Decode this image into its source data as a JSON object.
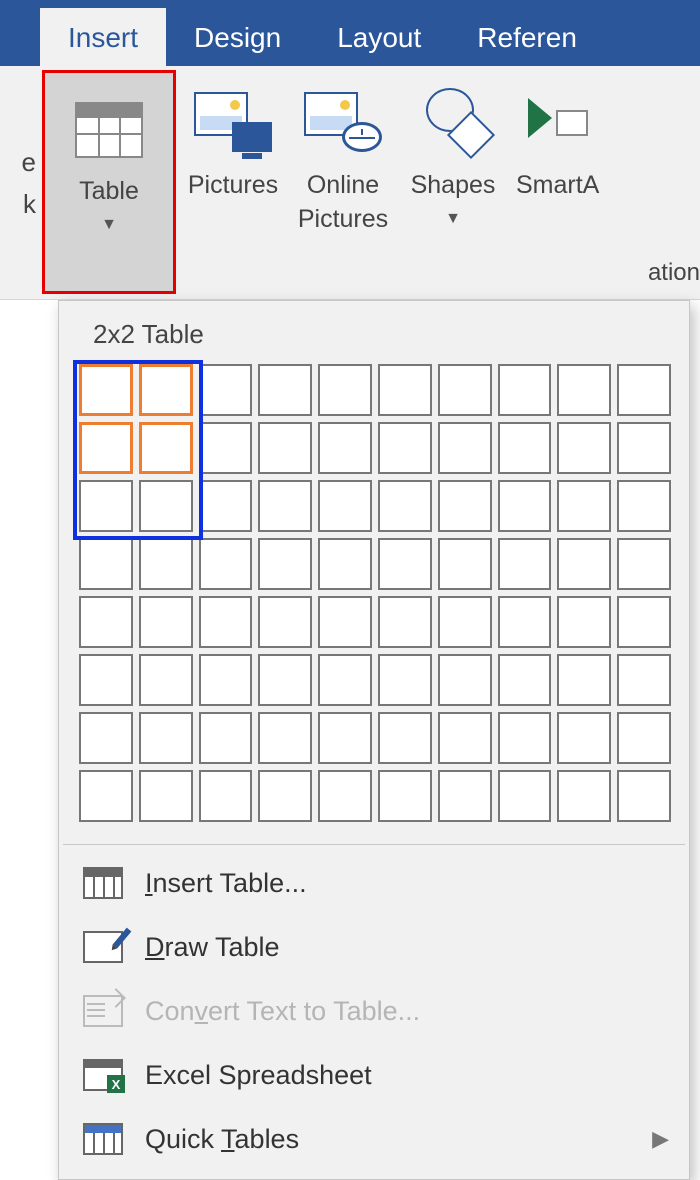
{
  "tabs": {
    "insert": "Insert",
    "design": "Design",
    "layout": "Layout",
    "references": "Referen"
  },
  "left_cut": {
    "l1": "e",
    "l2": "k"
  },
  "ribbon": {
    "table": "Table",
    "pictures": "Pictures",
    "online_l1": "Online",
    "online_l2": "Pictures",
    "shapes": "Shapes",
    "smartart": "SmartA"
  },
  "right_cut": "ation",
  "dropdown": {
    "title": "2x2 Table",
    "grid": {
      "rows": 8,
      "cols": 10,
      "selected_rows": 2,
      "selected_cols": 2
    },
    "items": {
      "insert_table": "Insert Table...",
      "draw_table": "Draw Table",
      "convert": "Convert Text to Table...",
      "excel": "Excel Spreadsheet",
      "quick": "Quick Tables"
    }
  }
}
